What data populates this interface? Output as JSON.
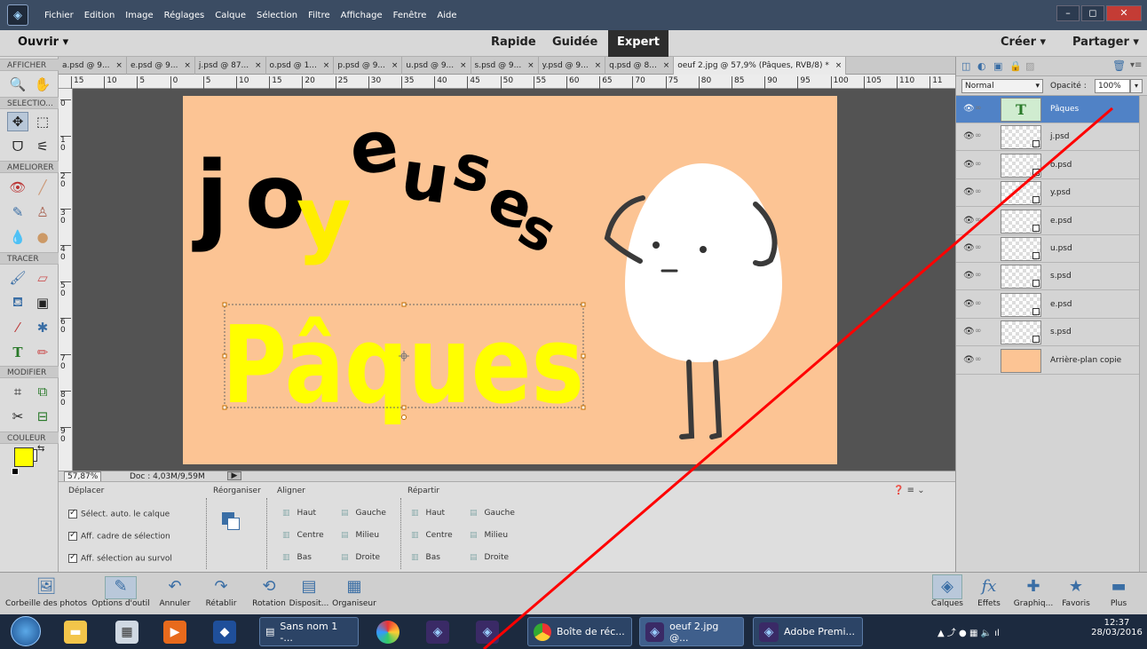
{
  "menu": [
    "Fichier",
    "Edition",
    "Image",
    "Réglages",
    "Calque",
    "Sélection",
    "Filtre",
    "Affichage",
    "Fenêtre",
    "Aide"
  ],
  "window_buttons": [
    "–",
    "◻",
    "✕"
  ],
  "modebar": {
    "open": "Ouvrir",
    "modes": [
      "Rapide",
      "Guidée",
      "Expert"
    ],
    "active_mode": "Expert",
    "create": "Créer",
    "share": "Partager"
  },
  "toolbar_sections": [
    "AFFICHER",
    "SELECTIO...",
    "AMELIORER",
    "TRACER",
    "MODIFIER",
    "COULEUR"
  ],
  "foreground_color": "#ffff00",
  "tabs": [
    "a.psd @ 9...",
    "e.psd @ 9...",
    "j.psd @ 87...",
    "o.psd @ 1...",
    "p.psd @ 9...",
    "u.psd @ 9...",
    "s.psd @ 9...",
    "y.psd @ 9...",
    "q.psd @ 8...",
    "oeuf 2.jpg @ 57,9% (Pâques, RVB/8) *"
  ],
  "ruler_h": [
    "15",
    "10",
    "5",
    "0",
    "5",
    "10",
    "15",
    "20",
    "25",
    "30",
    "35",
    "40",
    "45",
    "50",
    "55",
    "60",
    "65",
    "70",
    "75",
    "80",
    "85",
    "90",
    "95",
    "100",
    "105",
    "110",
    "11"
  ],
  "ruler_v": [
    "0",
    "1\n0",
    "2\n0",
    "3\n0",
    "4\n0",
    "5\n0",
    "6\n0",
    "7\n0",
    "8\n0",
    "9\n0"
  ],
  "canvas": {
    "bg_color": "#fcc494",
    "word1_letters": [
      "j",
      "o",
      "y",
      "e",
      "u",
      "s",
      "e",
      "s"
    ],
    "word2": "Pâques"
  },
  "status": {
    "zoom": "57,87%",
    "doc": "Doc : 4,03M/9,59M"
  },
  "options": {
    "move_title": "Déplacer",
    "checks": [
      "Sélect. auto. le calque",
      "Aff. cadre de sélection",
      "Aff. sélection au survol"
    ],
    "reorganize": "Réorganiser",
    "align": "Aligner",
    "align_items": [
      "Haut",
      "Gauche",
      "Centre",
      "Milieu",
      "Bas",
      "Droite"
    ],
    "distribute": "Répartir",
    "distribute_items": [
      "Haut",
      "Gauche",
      "Centre",
      "Milieu",
      "Bas",
      "Droite"
    ]
  },
  "layers_panel": {
    "blend_mode": "Normal",
    "opacity_label": "Opacité :",
    "opacity_value": "100%",
    "layers": [
      {
        "name": "Pâques",
        "type": "text",
        "selected": true
      },
      {
        "name": "j.psd",
        "type": "smart"
      },
      {
        "name": "o.psd",
        "type": "smart"
      },
      {
        "name": "y.psd",
        "type": "smart"
      },
      {
        "name": "e.psd",
        "type": "smart"
      },
      {
        "name": "u.psd",
        "type": "smart"
      },
      {
        "name": "s.psd",
        "type": "smart"
      },
      {
        "name": "e.psd",
        "type": "smart"
      },
      {
        "name": "s.psd",
        "type": "smart"
      },
      {
        "name": "Arrière-plan copie",
        "type": "bg"
      }
    ]
  },
  "appbar_left": [
    "Corbeille des photos",
    "Options d'outil",
    "Annuler",
    "Rétablir",
    "Rotation",
    "Disposit...",
    "Organiseur"
  ],
  "appbar_right": [
    "Calques",
    "Effets",
    "Graphiq...",
    "Favoris",
    "Plus"
  ],
  "taskbar": {
    "windows": [
      "Sans nom 1 -...",
      "Boîte de réc...",
      "oeuf 2.jpg @...",
      "Adobe Premi..."
    ],
    "time": "12:37",
    "date": "28/03/2016"
  }
}
